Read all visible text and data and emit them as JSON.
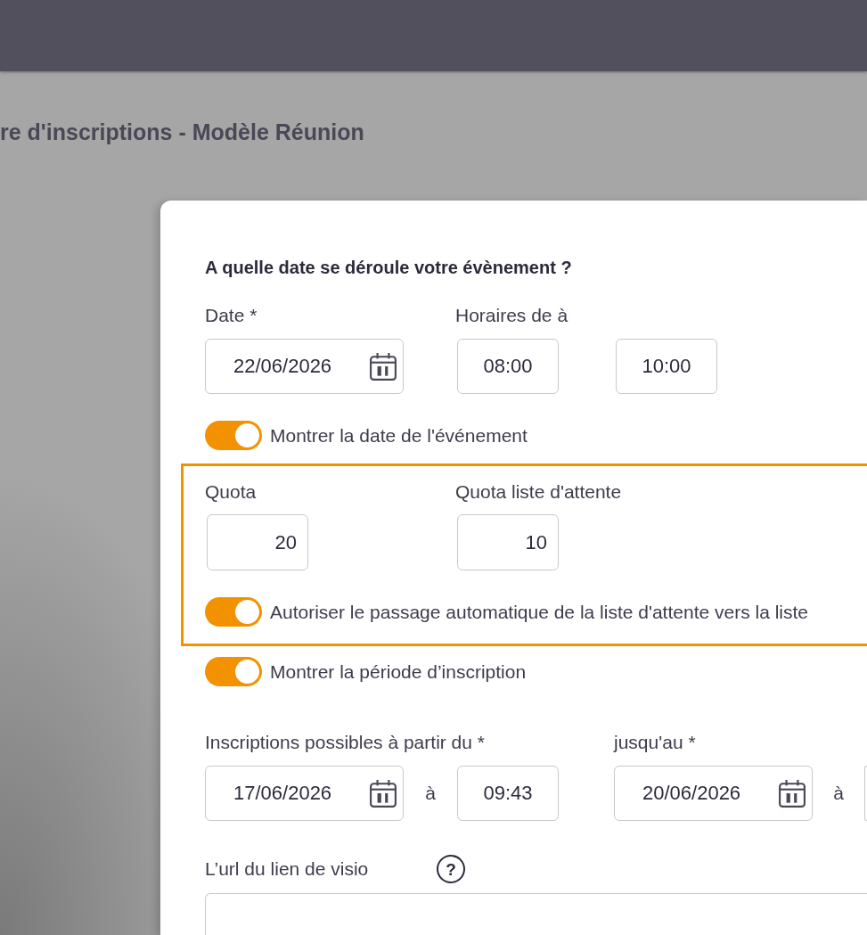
{
  "page_title": "re d'inscriptions - Modèle Réunion",
  "dialog": {
    "heading": "A quelle date se déroule votre évènement ?",
    "event_date": {
      "label": "Date *",
      "value": "22/06/2026"
    },
    "schedule": {
      "label": "Horaires de à",
      "start": "08:00",
      "end": "10:00"
    },
    "show_event_date": {
      "label": "Montrer la date de l'événement",
      "on": true
    },
    "quota_section": {
      "highlighted": true,
      "quota": {
        "label": "Quota",
        "value": "20"
      },
      "waitlist_quota": {
        "label": "Quota liste d'attente",
        "value": "10"
      },
      "auto_promote": {
        "label": "Autoriser le passage automatique de la liste d'attente vers la liste",
        "on": true
      }
    },
    "show_registration_period": {
      "label": "Montrer la période d’inscription",
      "on": true
    },
    "registration_start": {
      "label": "Inscriptions possibles à partir du *",
      "date": "17/06/2026",
      "separator": "à",
      "time": "09:43"
    },
    "registration_end": {
      "label": "jusqu'au *",
      "date": "20/06/2026",
      "separator": "à"
    },
    "visio_url": {
      "label": "L’url du lien de visio",
      "help": "?"
    }
  }
}
